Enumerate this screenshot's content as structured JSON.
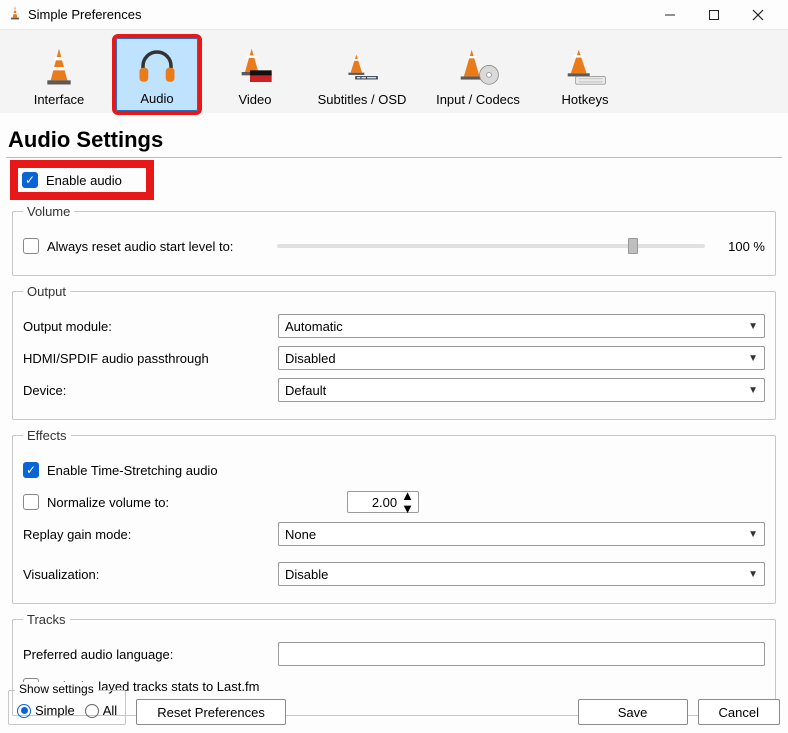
{
  "window": {
    "title": "Simple Preferences"
  },
  "tabs": [
    {
      "label": "Interface"
    },
    {
      "label": "Audio"
    },
    {
      "label": "Video"
    },
    {
      "label": "Subtitles / OSD"
    },
    {
      "label": "Input / Codecs"
    },
    {
      "label": "Hotkeys"
    }
  ],
  "heading": "Audio Settings",
  "enable_audio_label": "Enable audio",
  "volume": {
    "legend": "Volume",
    "reset_label": "Always reset audio start level to:",
    "slider_percent": 85,
    "percent_label": "100 %"
  },
  "output": {
    "legend": "Output",
    "module_label": "Output module:",
    "module_value": "Automatic",
    "passthrough_label": "HDMI/SPDIF audio passthrough",
    "passthrough_value": "Disabled",
    "device_label": "Device:",
    "device_value": "Default"
  },
  "effects": {
    "legend": "Effects",
    "time_stretch_label": "Enable Time-Stretching audio",
    "normalize_label": "Normalize volume to:",
    "normalize_value": "2.00",
    "replay_gain_label": "Replay gain mode:",
    "replay_gain_value": "None",
    "visualization_label": "Visualization:",
    "visualization_value": "Disable"
  },
  "tracks": {
    "legend": "Tracks",
    "preferred_lang_label": "Preferred audio language:",
    "preferred_lang_value": "",
    "lastfm_label": "Submit played tracks stats to Last.fm"
  },
  "bottom": {
    "show_settings_label": "Show settings",
    "simple_label": "Simple",
    "all_label": "All",
    "reset_label": "Reset Preferences",
    "save_label": "Save",
    "cancel_label": "Cancel"
  }
}
